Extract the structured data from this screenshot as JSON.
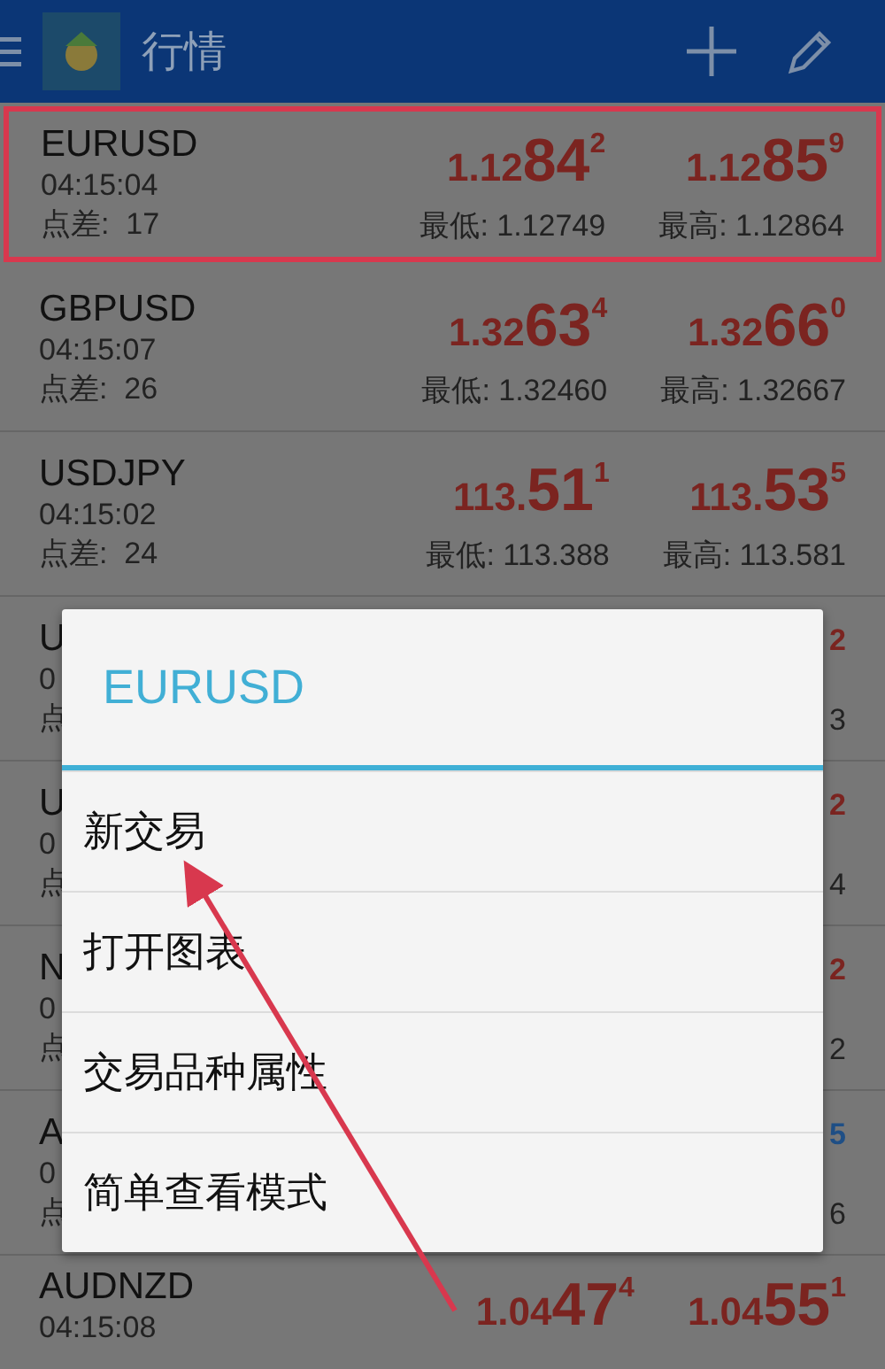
{
  "header": {
    "title": "行情"
  },
  "quotes": [
    {
      "kind": "full",
      "highlighted": true,
      "symbol": "EURUSD",
      "time": "04:15:04",
      "spread": "点差:  17",
      "color": "#7b2420",
      "bid": {
        "prefix": "1.12",
        "big": "84",
        "sup": "2"
      },
      "ask": {
        "prefix": "1.12",
        "big": "85",
        "sup": "9"
      },
      "low": "最低: 1.12749",
      "high": "最高: 1.12864"
    },
    {
      "kind": "full",
      "highlighted": false,
      "symbol": "GBPUSD",
      "time": "04:15:07",
      "spread": "点差:  26",
      "color": "#7b2420",
      "bid": {
        "prefix": "1.32",
        "big": "63",
        "sup": "4"
      },
      "ask": {
        "prefix": "1.32",
        "big": "66",
        "sup": "0"
      },
      "low": "最低: 1.32460",
      "high": "最高: 1.32667"
    },
    {
      "kind": "full",
      "highlighted": false,
      "symbol": "USDJPY",
      "time": "04:15:02",
      "spread": "点差:  24",
      "color": "#7b2420",
      "bid": {
        "prefix": "113.",
        "big": "51",
        "sup": "1"
      },
      "ask": {
        "prefix": "113.",
        "big": "53",
        "sup": "5"
      },
      "low": "最低: 113.388",
      "high": "最高: 113.581"
    },
    {
      "kind": "covered",
      "symbol": "U",
      "time": "0",
      "spread": "点",
      "color": "#7b2420",
      "ask_sup": "2",
      "high": "3"
    },
    {
      "kind": "covered",
      "symbol": "U",
      "time": "0",
      "spread": "点",
      "color": "#7b2420",
      "ask_sup": "2",
      "high": "4"
    },
    {
      "kind": "covered",
      "symbol": "N",
      "time": "0",
      "spread": "点",
      "color": "#7b2420",
      "ask_sup": "2",
      "high": "2"
    },
    {
      "kind": "covered",
      "symbol": "A",
      "time": "0",
      "spread": "点",
      "color": "#1f4f86",
      "ask_sup": "5",
      "high": "6"
    },
    {
      "kind": "cut",
      "symbol": "AUDNZD",
      "time": "04:15:08",
      "color": "#7b2420",
      "bid": {
        "prefix": "1.04",
        "big": "47",
        "sup": "4"
      },
      "ask": {
        "prefix": "1.04",
        "big": "55",
        "sup": "1"
      }
    }
  ],
  "dialog": {
    "title": "EURUSD",
    "items": [
      "新交易",
      "打开图表",
      "交易品种属性",
      "简单查看模式"
    ]
  }
}
